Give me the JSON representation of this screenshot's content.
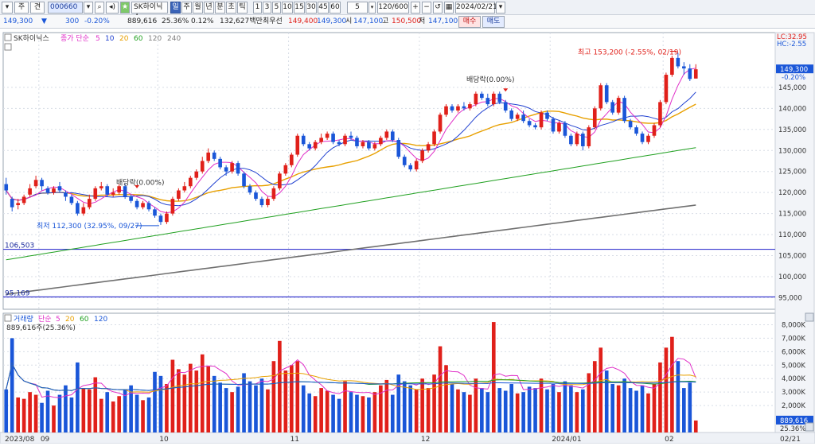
{
  "toolbar": {
    "buttons": [
      "주",
      "견"
    ],
    "code": "000660",
    "stock_name": "SK하이닉스",
    "periods": [
      "일",
      "주",
      "월",
      "년",
      "분",
      "초",
      "틱"
    ],
    "selected_period": "일",
    "minutes": [
      "1",
      "3",
      "5",
      "10",
      "15",
      "30",
      "45",
      "60"
    ],
    "count_value": "5",
    "range": "120/600",
    "date": "2024/02/21"
  },
  "quote": {
    "price": "149,300",
    "change": "300",
    "change_pct": "-0.20%",
    "volume": "889,616",
    "turnover_pct": "25.36%",
    "ratio_pct": "0.12%",
    "amount": "132,627백만",
    "best_ask_label": "최우선",
    "best_ask": "149,400",
    "best_bid": "149,300",
    "open_label": "시",
    "open": "147,100",
    "high_label": "고",
    "high": "150,500",
    "low_label": "저",
    "low": "147,100",
    "buy_label": "매수",
    "sell_label": "매도"
  },
  "price_panel": {
    "legend_stock": "SK하이닉스",
    "legend_ma_label": "종가 단순",
    "ma_periods": [
      "5",
      "10",
      "20",
      "60",
      "120",
      "240"
    ],
    "ma_colors": [
      "#e030c8",
      "#2040d0",
      "#e8a000",
      "#20a020",
      "#808080",
      "#808080"
    ],
    "lc_label": "LC:32.95",
    "hc_label": "HC:-2.55",
    "current_price_label": "149,300",
    "current_change_label": "-0.20%",
    "high_annotation": "최고 153,200 (-2.55%, 02/19)",
    "low_annotation": "최저 112,300 (32.95%, 09/27)",
    "dividend_label_1": "배당락(0.00%)",
    "dividend_label_2": "배당락(0.00%)",
    "hline_1": "106,503",
    "hline_2": "95,169",
    "y_ticks": [
      "145,000",
      "140,000",
      "135,000",
      "130,000",
      "125,000",
      "120,000",
      "115,000",
      "110,000",
      "105,000",
      "100,000",
      "95,000"
    ]
  },
  "volume_panel": {
    "legend_label": "거래량",
    "legend_ma_label": "단순",
    "ma_periods": [
      "5",
      "20",
      "60",
      "120"
    ],
    "ma_colors": [
      "#e030c8",
      "#e8a000",
      "#20a020",
      "#1a56d8"
    ],
    "value_label": "889,616주(25.36%)",
    "current_label": "889,616",
    "current_pct": "25.36%",
    "y_ticks": [
      "8,000K",
      "7,000K",
      "6,000K",
      "5,000K",
      "4,000K",
      "3,000K",
      "2,000K"
    ]
  },
  "x_axis": {
    "labels": [
      "2023/08",
      "09",
      "10",
      "11",
      "12",
      "2024/01",
      "02"
    ],
    "right_label": "02/21"
  },
  "colors": {
    "up": "#e0201a",
    "down": "#1a56d8",
    "grid": "#d8dde6",
    "hline": "#3a3ad0"
  },
  "chart_data": {
    "type": "candlestick",
    "period": "daily",
    "start": "2023-08-23",
    "end": "2024-02-21",
    "price_ylim": [
      93000,
      155000
    ],
    "volume_ylim": [
      0,
      8500000
    ],
    "markers": {
      "high": {
        "value": 153200,
        "date": "02/19"
      },
      "low": {
        "value": 112300,
        "date": "09/27"
      }
    },
    "horizontal_lines": [
      106503,
      95169
    ],
    "candles": [
      [
        122000,
        120500,
        123500,
        119500,
        3200000
      ],
      [
        118500,
        116500,
        119000,
        115500,
        7000000
      ],
      [
        117000,
        117500,
        118500,
        116000,
        2600000
      ],
      [
        117500,
        119000,
        119500,
        117000,
        2500000
      ],
      [
        119500,
        121000,
        122000,
        119000,
        3000000
      ],
      [
        121500,
        123000,
        124000,
        121000,
        2800000
      ],
      [
        123000,
        121500,
        123500,
        120500,
        2200000
      ],
      [
        121000,
        120000,
        121500,
        119500,
        3100000
      ],
      [
        120000,
        121000,
        121500,
        119500,
        2000000
      ],
      [
        121500,
        120500,
        122500,
        120000,
        2800000
      ],
      [
        120000,
        119000,
        120500,
        118000,
        3500000
      ],
      [
        119000,
        117500,
        119500,
        117000,
        2600000
      ],
      [
        117500,
        115000,
        118000,
        114500,
        5200000
      ],
      [
        115000,
        116500,
        117500,
        114500,
        3300000
      ],
      [
        116500,
        118500,
        119500,
        116000,
        3200000
      ],
      [
        118500,
        121000,
        121500,
        118000,
        4100000
      ],
      [
        121000,
        121500,
        122500,
        120500,
        2500000
      ],
      [
        121500,
        119500,
        122000,
        119000,
        3000000
      ],
      [
        119500,
        120000,
        121000,
        119000,
        2300000
      ],
      [
        120000,
        121500,
        122000,
        119500,
        2700000
      ],
      [
        121500,
        119000,
        122000,
        118500,
        3200000
      ],
      [
        119000,
        118000,
        119500,
        117500,
        3500000
      ],
      [
        118000,
        116500,
        118500,
        116000,
        2800000
      ],
      [
        116500,
        117500,
        118000,
        116000,
        2400000
      ],
      [
        117500,
        116000,
        118000,
        115500,
        2600000
      ],
      [
        116000,
        114500,
        116500,
        114000,
        4500000
      ],
      [
        114500,
        113000,
        115000,
        112300,
        4200000
      ],
      [
        113000,
        115000,
        115500,
        112500,
        3600000
      ],
      [
        115000,
        118500,
        119000,
        114500,
        5400000
      ],
      [
        118500,
        120500,
        121000,
        118000,
        4700000
      ],
      [
        120500,
        121500,
        122500,
        120000,
        4300000
      ],
      [
        121500,
        123500,
        124000,
        121000,
        5100000
      ],
      [
        123500,
        125000,
        125500,
        123000,
        4600000
      ],
      [
        125000,
        127500,
        128500,
        124500,
        5800000
      ],
      [
        127500,
        129500,
        130500,
        127000,
        4900000
      ],
      [
        129500,
        128000,
        130000,
        127500,
        4200000
      ],
      [
        128000,
        126000,
        128500,
        125500,
        3700000
      ],
      [
        126000,
        125000,
        126500,
        124000,
        3300000
      ],
      [
        125000,
        127000,
        127500,
        124500,
        3000000
      ],
      [
        127000,
        124500,
        127500,
        124000,
        3400000
      ],
      [
        124500,
        121500,
        125000,
        121000,
        4400000
      ],
      [
        121500,
        120000,
        122000,
        119500,
        3800000
      ],
      [
        120000,
        118500,
        120500,
        118000,
        3500000
      ],
      [
        118500,
        117000,
        119000,
        116500,
        4000000
      ],
      [
        117000,
        118500,
        119000,
        116500,
        3200000
      ],
      [
        118500,
        121000,
        121500,
        118000,
        5300000
      ],
      [
        121000,
        124500,
        125000,
        120500,
        6800000
      ],
      [
        124500,
        126500,
        127000,
        124000,
        4600000
      ],
      [
        126500,
        129000,
        129500,
        126000,
        5000000
      ],
      [
        129000,
        133500,
        134000,
        128500,
        5300000
      ],
      [
        133500,
        131500,
        134000,
        131000,
        3500000
      ],
      [
        131500,
        130500,
        132000,
        130000,
        2900000
      ],
      [
        130500,
        132000,
        132500,
        130000,
        2700000
      ],
      [
        132000,
        133000,
        134000,
        131500,
        3300000
      ],
      [
        133000,
        134000,
        134500,
        132500,
        3100000
      ],
      [
        134000,
        132000,
        134500,
        131500,
        2800000
      ],
      [
        132000,
        131500,
        132500,
        131000,
        2500000
      ],
      [
        131500,
        133500,
        134000,
        131000,
        3800000
      ],
      [
        133500,
        133000,
        134500,
        132500,
        3000000
      ],
      [
        133000,
        131000,
        133500,
        130500,
        2800000
      ],
      [
        131000,
        132000,
        132500,
        130500,
        2700000
      ],
      [
        132000,
        130500,
        132500,
        130000,
        2600000
      ],
      [
        130500,
        131500,
        132000,
        130000,
        3000000
      ],
      [
        131500,
        133000,
        133500,
        131000,
        3500000
      ],
      [
        133000,
        134500,
        135000,
        132500,
        3900000
      ],
      [
        134500,
        132500,
        135000,
        132000,
        2800000
      ],
      [
        132500,
        128500,
        133000,
        128000,
        4300000
      ],
      [
        128500,
        126500,
        129000,
        126000,
        3800000
      ],
      [
        126500,
        125500,
        127000,
        125000,
        3500000
      ],
      [
        125500,
        127500,
        128000,
        125000,
        3200000
      ],
      [
        127500,
        130000,
        130500,
        127000,
        4000000
      ],
      [
        130000,
        131500,
        132000,
        129500,
        3300000
      ],
      [
        131500,
        134500,
        135000,
        131000,
        4300000
      ],
      [
        134500,
        138500,
        139000,
        134000,
        6400000
      ],
      [
        138500,
        140500,
        141000,
        138000,
        5000000
      ],
      [
        140500,
        139500,
        141000,
        139000,
        3600000
      ],
      [
        139500,
        140500,
        141000,
        139000,
        3200000
      ],
      [
        140500,
        140000,
        141500,
        139500,
        3000000
      ],
      [
        140000,
        141000,
        141500,
        139500,
        2800000
      ],
      [
        141000,
        143500,
        144000,
        140500,
        4000000
      ],
      [
        143500,
        142500,
        144000,
        142000,
        3300000
      ],
      [
        142500,
        141000,
        143500,
        140500,
        3000000
      ],
      [
        141000,
        143500,
        144000,
        140500,
        8200000
      ],
      [
        143500,
        141500,
        144000,
        141000,
        3300000
      ],
      [
        141500,
        139500,
        142000,
        139000,
        3100000
      ],
      [
        139500,
        137500,
        140000,
        137000,
        3600000
      ],
      [
        137500,
        138500,
        139000,
        137000,
        2900000
      ],
      [
        138500,
        137000,
        139500,
        136500,
        3000000
      ],
      [
        137000,
        136000,
        137500,
        135500,
        3400000
      ],
      [
        136000,
        135500,
        136500,
        135000,
        3300000
      ],
      [
        135500,
        139000,
        139500,
        135000,
        4000000
      ],
      [
        139000,
        137500,
        139500,
        137000,
        3200000
      ],
      [
        137500,
        134500,
        138000,
        134000,
        3600000
      ],
      [
        134500,
        136500,
        137000,
        134000,
        3000000
      ],
      [
        136500,
        133500,
        137000,
        133000,
        3800000
      ],
      [
        133500,
        131500,
        134000,
        131000,
        3500000
      ],
      [
        131500,
        134000,
        134500,
        131000,
        3000000
      ],
      [
        134000,
        131000,
        134500,
        130000,
        3200000
      ],
      [
        131000,
        135500,
        136000,
        130500,
        4400000
      ],
      [
        135500,
        140000,
        140500,
        135000,
        5300000
      ],
      [
        140000,
        145500,
        146000,
        139500,
        6300000
      ],
      [
        145500,
        141500,
        146000,
        141000,
        4600000
      ],
      [
        141500,
        139000,
        142000,
        138500,
        3600000
      ],
      [
        139000,
        142500,
        143000,
        138500,
        3500000
      ],
      [
        142500,
        137000,
        143000,
        136500,
        4000000
      ],
      [
        137000,
        135500,
        137500,
        135000,
        3300000
      ],
      [
        135500,
        134000,
        136000,
        133500,
        3100000
      ],
      [
        134000,
        132000,
        134500,
        131500,
        3500000
      ],
      [
        132000,
        133500,
        134000,
        131500,
        2900000
      ],
      [
        133500,
        136000,
        136500,
        133000,
        3600000
      ],
      [
        136000,
        141500,
        142000,
        135500,
        5200000
      ],
      [
        141500,
        148000,
        148500,
        141000,
        6300000
      ],
      [
        148000,
        152000,
        152500,
        147500,
        7100000
      ],
      [
        152000,
        150000,
        153200,
        149500,
        5300000
      ],
      [
        150000,
        149500,
        151000,
        148000,
        3300000
      ],
      [
        149500,
        147000,
        150500,
        146500,
        3700000
      ],
      [
        147100,
        149300,
        150500,
        147100,
        889616
      ]
    ]
  }
}
